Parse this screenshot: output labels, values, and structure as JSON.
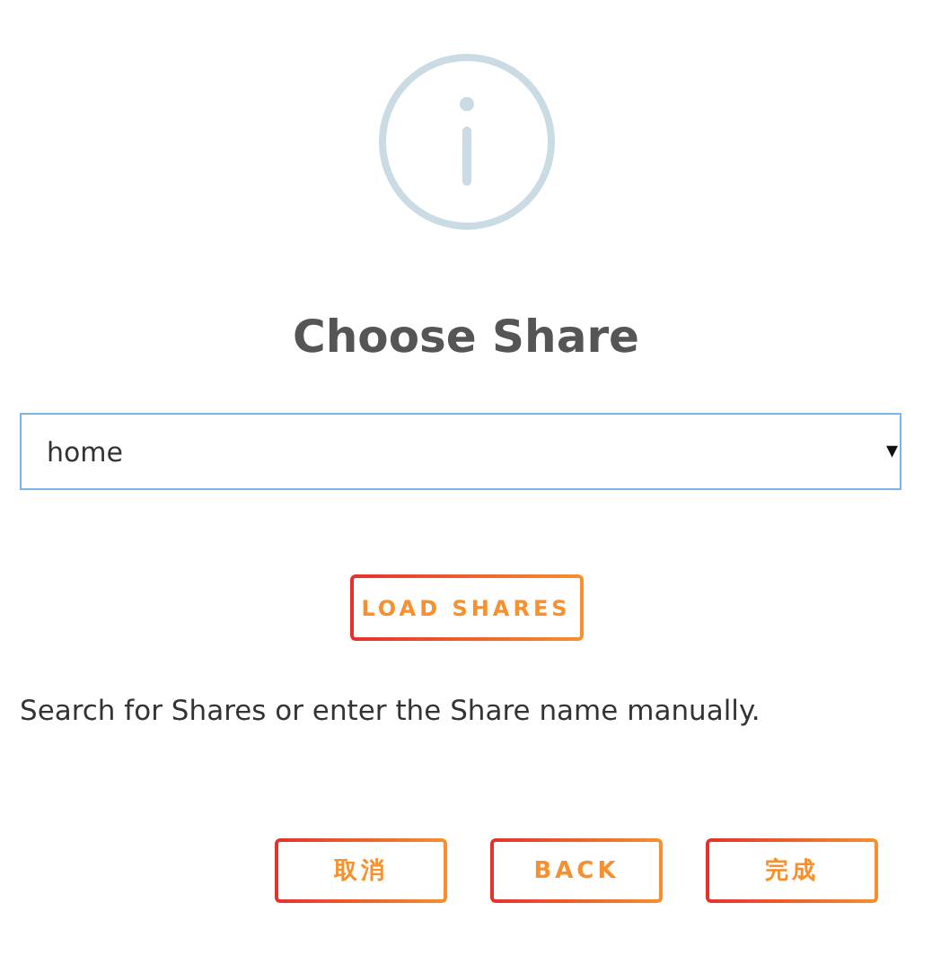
{
  "title": "Choose Share",
  "share_select": {
    "value": "home",
    "caret": "▾"
  },
  "load_button": "LOAD SHARES",
  "hint": "Search for Shares or enter the Share name manually.",
  "buttons": [
    {
      "label": "取消"
    },
    {
      "label": "BACK"
    },
    {
      "label": "完成"
    }
  ]
}
